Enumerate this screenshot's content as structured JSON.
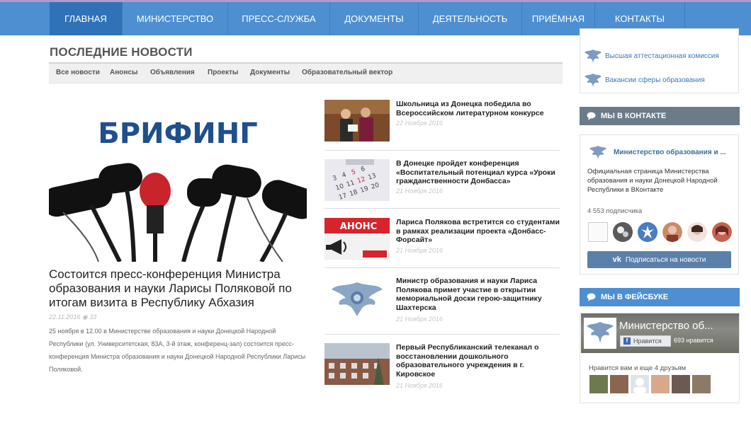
{
  "nav": {
    "items": [
      "ГЛАВНАЯ",
      "МИНИСТЕРСТВО",
      "ПРЕСС-СЛУЖБА",
      "ДОКУМЕНТЫ",
      "ДЕЯТЕЛЬНОСТЬ",
      "ПРИЁМНАЯ",
      "КОНТАКТЫ"
    ],
    "active": "ГЛАВНАЯ"
  },
  "news": {
    "section_title": "ПОСЛЕДНИЕ НОВОСТИ",
    "filters": [
      "Все новости",
      "Анонсы",
      "Объявления",
      "Проекты",
      "Документы",
      "Образовательный вектор"
    ],
    "featured": {
      "image_caption": "БРИФИНГ",
      "title": "Состоится пресс-конференция Министра образования и науки Ларисы Поляковой по итогам визита в Республику Абхазия",
      "date": "22.11.2016",
      "views": "33",
      "text": "25 ноября в 12.00 в Министерстве образования и науки Донецкой Народной Республики (ул. Университетская, 83А, 3-й этаж, конференц-зал) состоится пресс-конференция Министра образования и науки Донецкой Народной Республики Ларисы Поляковой."
    },
    "list": [
      {
        "title": "Школьница из Донецка победила во Всероссийском литературном конкурсе",
        "date": "22 Ноября 2016"
      },
      {
        "title": "В Донецке пройдет конференция «Воспитательный потенциал курса «Уроки гражданственности Донбасса»",
        "date": "21 Ноября 2016"
      },
      {
        "title": "Лариса Полякова встретится со студентами в рамках реализации проекта «Донбасс-Форсайт»",
        "date": "21 Ноября 2016",
        "thumb_label": "АНОНС"
      },
      {
        "title": "Министр образования и науки Лариса Полякова примет участие в открытии мемориальной доски герою-защитнику Шахтерска",
        "date": "21 Ноября 2016"
      },
      {
        "title": "Первый Республиканский телеканал о восстановлении дошкольного образовательного учреждения в г. Кировское",
        "date": "21 Ноября 2016"
      }
    ]
  },
  "sidebar": {
    "links": [
      "Высшая аттестационная комиссия",
      "Вакансии сферы образования"
    ],
    "vk": {
      "heading": "МЫ В КОНТАКТЕ",
      "group_name": "Министерство образования и ...",
      "description": "Официальная страница Министерства образования и науки Донецкой Народной Республики в ВКонтакте",
      "subscribers": "4 553 подписчика",
      "button": "Подписаться на новости"
    },
    "fb": {
      "heading": "МЫ В ФЕЙСБУКЕ",
      "page_name": "Министерство об...",
      "like_button": "Нравится",
      "likes": "693 нравится",
      "friends_text": "Нравится вам и еще 4 друзьям"
    }
  },
  "colors": {
    "nav": "#4d8fd1",
    "nav_active": "#2f72b8",
    "vk_heading": "#6b7b8a",
    "fb_heading": "#4d8fd1",
    "vk_button": "#5b80aa",
    "link": "#3e76b4"
  }
}
